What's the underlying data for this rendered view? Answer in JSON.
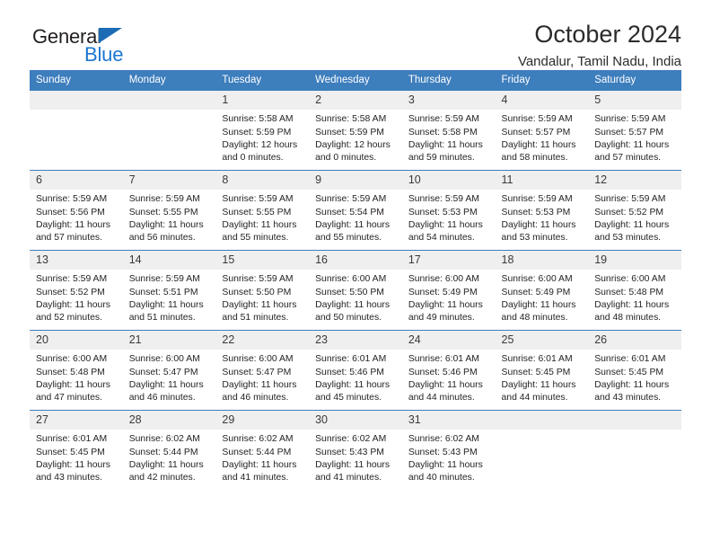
{
  "brand": {
    "name_top": "General",
    "name_bottom": "Blue",
    "triangle_color": "#1b6cb5",
    "blue_color": "#1b76d2"
  },
  "header": {
    "title": "October 2024",
    "subtitle": "Vandalur, Tamil Nadu, India"
  },
  "theme": {
    "header_bg": "#3d7ebd",
    "daynum_bg": "#efefef",
    "row_rule": "#3d7ebd",
    "text": "#231f20"
  },
  "weekday_headers": [
    "Sunday",
    "Monday",
    "Tuesday",
    "Wednesday",
    "Thursday",
    "Friday",
    "Saturday"
  ],
  "weeks": [
    [
      {
        "day": "",
        "sunrise": "",
        "sunset": "",
        "daylight_line1": "",
        "daylight_line2": ""
      },
      {
        "day": "",
        "sunrise": "",
        "sunset": "",
        "daylight_line1": "",
        "daylight_line2": ""
      },
      {
        "day": "1",
        "sunrise": "Sunrise: 5:58 AM",
        "sunset": "Sunset: 5:59 PM",
        "daylight_line1": "Daylight: 12 hours",
        "daylight_line2": "and 0 minutes."
      },
      {
        "day": "2",
        "sunrise": "Sunrise: 5:58 AM",
        "sunset": "Sunset: 5:59 PM",
        "daylight_line1": "Daylight: 12 hours",
        "daylight_line2": "and 0 minutes."
      },
      {
        "day": "3",
        "sunrise": "Sunrise: 5:59 AM",
        "sunset": "Sunset: 5:58 PM",
        "daylight_line1": "Daylight: 11 hours",
        "daylight_line2": "and 59 minutes."
      },
      {
        "day": "4",
        "sunrise": "Sunrise: 5:59 AM",
        "sunset": "Sunset: 5:57 PM",
        "daylight_line1": "Daylight: 11 hours",
        "daylight_line2": "and 58 minutes."
      },
      {
        "day": "5",
        "sunrise": "Sunrise: 5:59 AM",
        "sunset": "Sunset: 5:57 PM",
        "daylight_line1": "Daylight: 11 hours",
        "daylight_line2": "and 57 minutes."
      }
    ],
    [
      {
        "day": "6",
        "sunrise": "Sunrise: 5:59 AM",
        "sunset": "Sunset: 5:56 PM",
        "daylight_line1": "Daylight: 11 hours",
        "daylight_line2": "and 57 minutes."
      },
      {
        "day": "7",
        "sunrise": "Sunrise: 5:59 AM",
        "sunset": "Sunset: 5:55 PM",
        "daylight_line1": "Daylight: 11 hours",
        "daylight_line2": "and 56 minutes."
      },
      {
        "day": "8",
        "sunrise": "Sunrise: 5:59 AM",
        "sunset": "Sunset: 5:55 PM",
        "daylight_line1": "Daylight: 11 hours",
        "daylight_line2": "and 55 minutes."
      },
      {
        "day": "9",
        "sunrise": "Sunrise: 5:59 AM",
        "sunset": "Sunset: 5:54 PM",
        "daylight_line1": "Daylight: 11 hours",
        "daylight_line2": "and 55 minutes."
      },
      {
        "day": "10",
        "sunrise": "Sunrise: 5:59 AM",
        "sunset": "Sunset: 5:53 PM",
        "daylight_line1": "Daylight: 11 hours",
        "daylight_line2": "and 54 minutes."
      },
      {
        "day": "11",
        "sunrise": "Sunrise: 5:59 AM",
        "sunset": "Sunset: 5:53 PM",
        "daylight_line1": "Daylight: 11 hours",
        "daylight_line2": "and 53 minutes."
      },
      {
        "day": "12",
        "sunrise": "Sunrise: 5:59 AM",
        "sunset": "Sunset: 5:52 PM",
        "daylight_line1": "Daylight: 11 hours",
        "daylight_line2": "and 53 minutes."
      }
    ],
    [
      {
        "day": "13",
        "sunrise": "Sunrise: 5:59 AM",
        "sunset": "Sunset: 5:52 PM",
        "daylight_line1": "Daylight: 11 hours",
        "daylight_line2": "and 52 minutes."
      },
      {
        "day": "14",
        "sunrise": "Sunrise: 5:59 AM",
        "sunset": "Sunset: 5:51 PM",
        "daylight_line1": "Daylight: 11 hours",
        "daylight_line2": "and 51 minutes."
      },
      {
        "day": "15",
        "sunrise": "Sunrise: 5:59 AM",
        "sunset": "Sunset: 5:50 PM",
        "daylight_line1": "Daylight: 11 hours",
        "daylight_line2": "and 51 minutes."
      },
      {
        "day": "16",
        "sunrise": "Sunrise: 6:00 AM",
        "sunset": "Sunset: 5:50 PM",
        "daylight_line1": "Daylight: 11 hours",
        "daylight_line2": "and 50 minutes."
      },
      {
        "day": "17",
        "sunrise": "Sunrise: 6:00 AM",
        "sunset": "Sunset: 5:49 PM",
        "daylight_line1": "Daylight: 11 hours",
        "daylight_line2": "and 49 minutes."
      },
      {
        "day": "18",
        "sunrise": "Sunrise: 6:00 AM",
        "sunset": "Sunset: 5:49 PM",
        "daylight_line1": "Daylight: 11 hours",
        "daylight_line2": "and 48 minutes."
      },
      {
        "day": "19",
        "sunrise": "Sunrise: 6:00 AM",
        "sunset": "Sunset: 5:48 PM",
        "daylight_line1": "Daylight: 11 hours",
        "daylight_line2": "and 48 minutes."
      }
    ],
    [
      {
        "day": "20",
        "sunrise": "Sunrise: 6:00 AM",
        "sunset": "Sunset: 5:48 PM",
        "daylight_line1": "Daylight: 11 hours",
        "daylight_line2": "and 47 minutes."
      },
      {
        "day": "21",
        "sunrise": "Sunrise: 6:00 AM",
        "sunset": "Sunset: 5:47 PM",
        "daylight_line1": "Daylight: 11 hours",
        "daylight_line2": "and 46 minutes."
      },
      {
        "day": "22",
        "sunrise": "Sunrise: 6:00 AM",
        "sunset": "Sunset: 5:47 PM",
        "daylight_line1": "Daylight: 11 hours",
        "daylight_line2": "and 46 minutes."
      },
      {
        "day": "23",
        "sunrise": "Sunrise: 6:01 AM",
        "sunset": "Sunset: 5:46 PM",
        "daylight_line1": "Daylight: 11 hours",
        "daylight_line2": "and 45 minutes."
      },
      {
        "day": "24",
        "sunrise": "Sunrise: 6:01 AM",
        "sunset": "Sunset: 5:46 PM",
        "daylight_line1": "Daylight: 11 hours",
        "daylight_line2": "and 44 minutes."
      },
      {
        "day": "25",
        "sunrise": "Sunrise: 6:01 AM",
        "sunset": "Sunset: 5:45 PM",
        "daylight_line1": "Daylight: 11 hours",
        "daylight_line2": "and 44 minutes."
      },
      {
        "day": "26",
        "sunrise": "Sunrise: 6:01 AM",
        "sunset": "Sunset: 5:45 PM",
        "daylight_line1": "Daylight: 11 hours",
        "daylight_line2": "and 43 minutes."
      }
    ],
    [
      {
        "day": "27",
        "sunrise": "Sunrise: 6:01 AM",
        "sunset": "Sunset: 5:45 PM",
        "daylight_line1": "Daylight: 11 hours",
        "daylight_line2": "and 43 minutes."
      },
      {
        "day": "28",
        "sunrise": "Sunrise: 6:02 AM",
        "sunset": "Sunset: 5:44 PM",
        "daylight_line1": "Daylight: 11 hours",
        "daylight_line2": "and 42 minutes."
      },
      {
        "day": "29",
        "sunrise": "Sunrise: 6:02 AM",
        "sunset": "Sunset: 5:44 PM",
        "daylight_line1": "Daylight: 11 hours",
        "daylight_line2": "and 41 minutes."
      },
      {
        "day": "30",
        "sunrise": "Sunrise: 6:02 AM",
        "sunset": "Sunset: 5:43 PM",
        "daylight_line1": "Daylight: 11 hours",
        "daylight_line2": "and 41 minutes."
      },
      {
        "day": "31",
        "sunrise": "Sunrise: 6:02 AM",
        "sunset": "Sunset: 5:43 PM",
        "daylight_line1": "Daylight: 11 hours",
        "daylight_line2": "and 40 minutes."
      },
      {
        "day": "",
        "sunrise": "",
        "sunset": "",
        "daylight_line1": "",
        "daylight_line2": ""
      },
      {
        "day": "",
        "sunrise": "",
        "sunset": "",
        "daylight_line1": "",
        "daylight_line2": ""
      }
    ]
  ]
}
